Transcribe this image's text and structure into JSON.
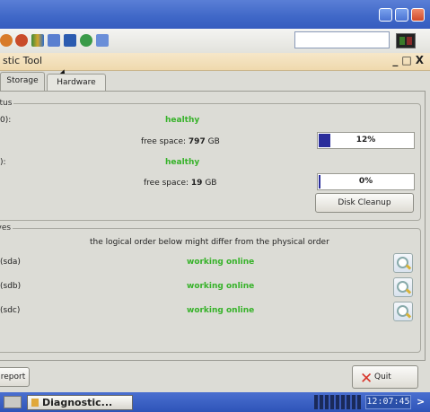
{
  "window": {
    "title": "stic Tool",
    "controls": "_□X"
  },
  "tabs": [
    {
      "label": "Storage"
    },
    {
      "label": "Hardware"
    }
  ],
  "storage_status": {
    "legend": "atus",
    "disks": [
      {
        "label": "0):",
        "status": "healthy",
        "free_prefix": "free space:",
        "free_value": "797",
        "free_unit": "GB",
        "usage_pct": 12,
        "usage_label": "12%"
      },
      {
        "label": "):",
        "status": "healthy",
        "free_prefix": "free space:",
        "free_value": "19",
        "free_unit": "GB",
        "usage_pct": 0,
        "usage_label": "0%"
      }
    ],
    "cleanup_button": "Disk Cleanup"
  },
  "drives": {
    "legend": "ives",
    "note": "the logical order below might differ from the physical order",
    "items": [
      {
        "label": "(sda)",
        "status": "working online"
      },
      {
        "label": "(sdb)",
        "status": "working online"
      },
      {
        "label": "(sdc)",
        "status": "working online"
      }
    ]
  },
  "bottom": {
    "report_button": "report",
    "quit_button": "Quit"
  },
  "taskbar": {
    "task_label": "Diagnostic...",
    "clock": "12:07:45",
    "arrow": ">"
  },
  "colors": {
    "status_green": "#36b229",
    "bar_fill": "#2a2d9b",
    "titlebar_blue": "#3f67c7"
  }
}
